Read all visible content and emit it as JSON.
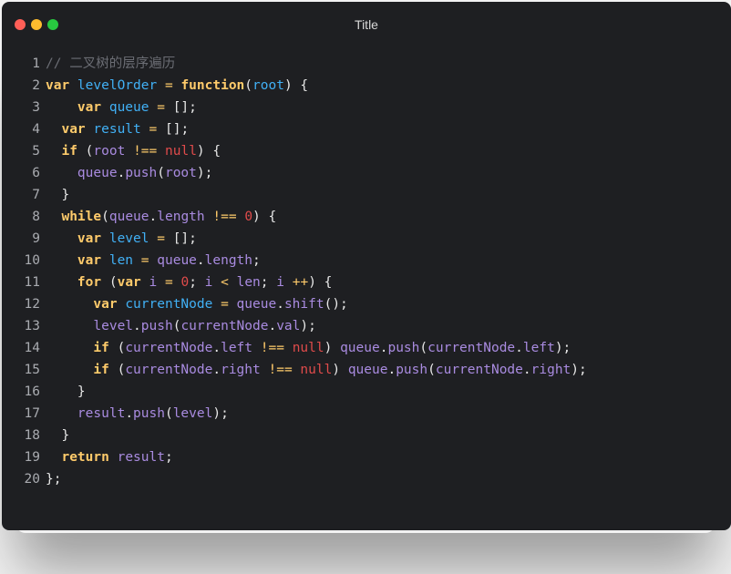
{
  "window": {
    "title": "Title"
  },
  "colors": {
    "background": "#1e1f22",
    "keyword": "#ffcb6b",
    "identifier": "#41b0f5",
    "function": "#a98be0",
    "null": "#e04b4b",
    "comment": "#6b6d74"
  },
  "code": {
    "lines": [
      {
        "n": "1",
        "tokens": [
          {
            "t": "cm",
            "s": "// 二叉树的层序遍历"
          }
        ]
      },
      {
        "n": "2",
        "tokens": [
          {
            "t": "var",
            "s": "var "
          },
          {
            "t": "id",
            "s": "levelOrder"
          },
          {
            "t": "punc",
            "s": " "
          },
          {
            "t": "op",
            "s": "="
          },
          {
            "t": "punc",
            "s": " "
          },
          {
            "t": "kw",
            "s": "function"
          },
          {
            "t": "punc",
            "s": "("
          },
          {
            "t": "id",
            "s": "root"
          },
          {
            "t": "punc",
            "s": ") {"
          }
        ]
      },
      {
        "n": "3",
        "tokens": [
          {
            "t": "punc",
            "s": "    "
          },
          {
            "t": "var",
            "s": "var "
          },
          {
            "t": "id",
            "s": "queue"
          },
          {
            "t": "punc",
            "s": " "
          },
          {
            "t": "op",
            "s": "="
          },
          {
            "t": "punc",
            "s": " [];"
          }
        ]
      },
      {
        "n": "4",
        "tokens": [
          {
            "t": "punc",
            "s": "  "
          },
          {
            "t": "var",
            "s": "var "
          },
          {
            "t": "id",
            "s": "result"
          },
          {
            "t": "punc",
            "s": " "
          },
          {
            "t": "op",
            "s": "="
          },
          {
            "t": "punc",
            "s": " [];"
          }
        ]
      },
      {
        "n": "5",
        "tokens": [
          {
            "t": "punc",
            "s": "  "
          },
          {
            "t": "kw",
            "s": "if"
          },
          {
            "t": "punc",
            "s": " ("
          },
          {
            "t": "prop",
            "s": "root"
          },
          {
            "t": "punc",
            "s": " "
          },
          {
            "t": "op",
            "s": "!=="
          },
          {
            "t": "punc",
            "s": " "
          },
          {
            "t": "null",
            "s": "null"
          },
          {
            "t": "punc",
            "s": ") {"
          }
        ]
      },
      {
        "n": "6",
        "tokens": [
          {
            "t": "punc",
            "s": "    "
          },
          {
            "t": "prop",
            "s": "queue"
          },
          {
            "t": "punc",
            "s": "."
          },
          {
            "t": "fn",
            "s": "push"
          },
          {
            "t": "punc",
            "s": "("
          },
          {
            "t": "prop",
            "s": "root"
          },
          {
            "t": "punc",
            "s": ");"
          }
        ]
      },
      {
        "n": "7",
        "tokens": [
          {
            "t": "punc",
            "s": "  }"
          }
        ]
      },
      {
        "n": "8",
        "tokens": [
          {
            "t": "punc",
            "s": "  "
          },
          {
            "t": "kw",
            "s": "while"
          },
          {
            "t": "punc",
            "s": "("
          },
          {
            "t": "prop",
            "s": "queue"
          },
          {
            "t": "punc",
            "s": "."
          },
          {
            "t": "prop",
            "s": "length"
          },
          {
            "t": "punc",
            "s": " "
          },
          {
            "t": "op",
            "s": "!=="
          },
          {
            "t": "punc",
            "s": " "
          },
          {
            "t": "num",
            "s": "0"
          },
          {
            "t": "punc",
            "s": ") {"
          }
        ]
      },
      {
        "n": "9",
        "tokens": [
          {
            "t": "punc",
            "s": "    "
          },
          {
            "t": "var",
            "s": "var "
          },
          {
            "t": "id",
            "s": "level"
          },
          {
            "t": "punc",
            "s": " "
          },
          {
            "t": "op",
            "s": "="
          },
          {
            "t": "punc",
            "s": " [];"
          }
        ]
      },
      {
        "n": "10",
        "tokens": [
          {
            "t": "punc",
            "s": "    "
          },
          {
            "t": "var",
            "s": "var "
          },
          {
            "t": "id",
            "s": "len"
          },
          {
            "t": "punc",
            "s": " "
          },
          {
            "t": "op",
            "s": "="
          },
          {
            "t": "punc",
            "s": " "
          },
          {
            "t": "prop",
            "s": "queue"
          },
          {
            "t": "punc",
            "s": "."
          },
          {
            "t": "prop",
            "s": "length"
          },
          {
            "t": "punc",
            "s": ";"
          }
        ]
      },
      {
        "n": "11",
        "tokens": [
          {
            "t": "punc",
            "s": "    "
          },
          {
            "t": "kw",
            "s": "for"
          },
          {
            "t": "punc",
            "s": " ("
          },
          {
            "t": "var",
            "s": "var "
          },
          {
            "t": "prop",
            "s": "i"
          },
          {
            "t": "punc",
            "s": " "
          },
          {
            "t": "op",
            "s": "="
          },
          {
            "t": "punc",
            "s": " "
          },
          {
            "t": "num",
            "s": "0"
          },
          {
            "t": "punc",
            "s": "; "
          },
          {
            "t": "prop",
            "s": "i"
          },
          {
            "t": "punc",
            "s": " "
          },
          {
            "t": "op",
            "s": "<"
          },
          {
            "t": "punc",
            "s": " "
          },
          {
            "t": "prop",
            "s": "len"
          },
          {
            "t": "punc",
            "s": "; "
          },
          {
            "t": "prop",
            "s": "i"
          },
          {
            "t": "punc",
            "s": " "
          },
          {
            "t": "op",
            "s": "++"
          },
          {
            "t": "punc",
            "s": ") {"
          }
        ]
      },
      {
        "n": "12",
        "tokens": [
          {
            "t": "punc",
            "s": "      "
          },
          {
            "t": "var",
            "s": "var "
          },
          {
            "t": "id",
            "s": "currentNode"
          },
          {
            "t": "punc",
            "s": " "
          },
          {
            "t": "op",
            "s": "="
          },
          {
            "t": "punc",
            "s": " "
          },
          {
            "t": "prop",
            "s": "queue"
          },
          {
            "t": "punc",
            "s": "."
          },
          {
            "t": "fn",
            "s": "shift"
          },
          {
            "t": "punc",
            "s": "();"
          }
        ]
      },
      {
        "n": "13",
        "tokens": [
          {
            "t": "punc",
            "s": "      "
          },
          {
            "t": "prop",
            "s": "level"
          },
          {
            "t": "punc",
            "s": "."
          },
          {
            "t": "fn",
            "s": "push"
          },
          {
            "t": "punc",
            "s": "("
          },
          {
            "t": "prop",
            "s": "currentNode"
          },
          {
            "t": "punc",
            "s": "."
          },
          {
            "t": "prop",
            "s": "val"
          },
          {
            "t": "punc",
            "s": ");"
          }
        ]
      },
      {
        "n": "14",
        "tokens": [
          {
            "t": "punc",
            "s": "      "
          },
          {
            "t": "kw",
            "s": "if"
          },
          {
            "t": "punc",
            "s": " ("
          },
          {
            "t": "prop",
            "s": "currentNode"
          },
          {
            "t": "punc",
            "s": "."
          },
          {
            "t": "prop",
            "s": "left"
          },
          {
            "t": "punc",
            "s": " "
          },
          {
            "t": "op",
            "s": "!=="
          },
          {
            "t": "punc",
            "s": " "
          },
          {
            "t": "null",
            "s": "null"
          },
          {
            "t": "punc",
            "s": ") "
          },
          {
            "t": "prop",
            "s": "queue"
          },
          {
            "t": "punc",
            "s": "."
          },
          {
            "t": "fn",
            "s": "push"
          },
          {
            "t": "punc",
            "s": "("
          },
          {
            "t": "prop",
            "s": "currentNode"
          },
          {
            "t": "punc",
            "s": "."
          },
          {
            "t": "prop",
            "s": "left"
          },
          {
            "t": "punc",
            "s": ");"
          }
        ]
      },
      {
        "n": "15",
        "tokens": [
          {
            "t": "punc",
            "s": "      "
          },
          {
            "t": "kw",
            "s": "if"
          },
          {
            "t": "punc",
            "s": " ("
          },
          {
            "t": "prop",
            "s": "currentNode"
          },
          {
            "t": "punc",
            "s": "."
          },
          {
            "t": "prop",
            "s": "right"
          },
          {
            "t": "punc",
            "s": " "
          },
          {
            "t": "op",
            "s": "!=="
          },
          {
            "t": "punc",
            "s": " "
          },
          {
            "t": "null",
            "s": "null"
          },
          {
            "t": "punc",
            "s": ") "
          },
          {
            "t": "prop",
            "s": "queue"
          },
          {
            "t": "punc",
            "s": "."
          },
          {
            "t": "fn",
            "s": "push"
          },
          {
            "t": "punc",
            "s": "("
          },
          {
            "t": "prop",
            "s": "currentNode"
          },
          {
            "t": "punc",
            "s": "."
          },
          {
            "t": "prop",
            "s": "right"
          },
          {
            "t": "punc",
            "s": ");"
          }
        ]
      },
      {
        "n": "16",
        "tokens": [
          {
            "t": "punc",
            "s": "    }"
          }
        ]
      },
      {
        "n": "17",
        "tokens": [
          {
            "t": "punc",
            "s": "    "
          },
          {
            "t": "prop",
            "s": "result"
          },
          {
            "t": "punc",
            "s": "."
          },
          {
            "t": "fn",
            "s": "push"
          },
          {
            "t": "punc",
            "s": "("
          },
          {
            "t": "prop",
            "s": "level"
          },
          {
            "t": "punc",
            "s": ");"
          }
        ]
      },
      {
        "n": "18",
        "tokens": [
          {
            "t": "punc",
            "s": "  }"
          }
        ]
      },
      {
        "n": "19",
        "tokens": [
          {
            "t": "punc",
            "s": "  "
          },
          {
            "t": "kw",
            "s": "return"
          },
          {
            "t": "punc",
            "s": " "
          },
          {
            "t": "prop",
            "s": "result"
          },
          {
            "t": "punc",
            "s": ";"
          }
        ]
      },
      {
        "n": "20",
        "tokens": [
          {
            "t": "punc",
            "s": "};"
          }
        ]
      }
    ]
  }
}
